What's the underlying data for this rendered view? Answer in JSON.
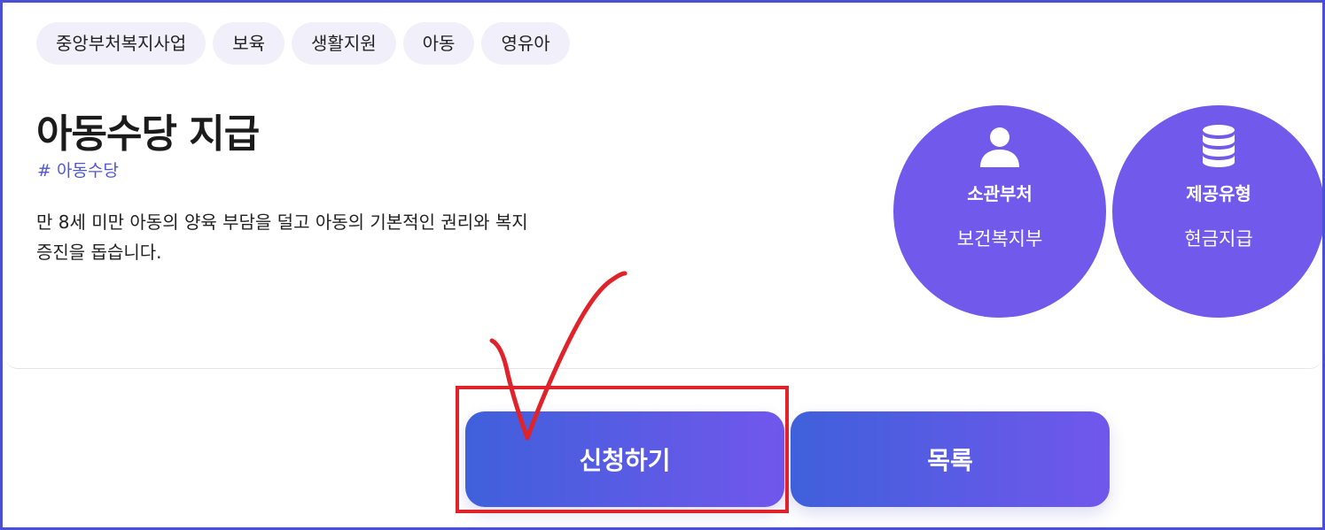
{
  "tags": [
    "중앙부처복지사업",
    "보육",
    "생활지원",
    "아동",
    "영유아"
  ],
  "service": {
    "title": "아동수당 지급",
    "hashtag": "# 아동수당",
    "description": "만 8세 미만 아동의 양육 부담을 덜고 아동의 기본적인 권리와 복지 증진을 돕습니다."
  },
  "info": {
    "ministry": {
      "label": "소관부처",
      "value": "보건복지부",
      "icon": "person-icon"
    },
    "provide_type": {
      "label": "제공유형",
      "value": "현금지급",
      "icon": "coin-stack-icon"
    }
  },
  "buttons": {
    "apply_label": "신청하기",
    "list_label": "목록"
  },
  "colors": {
    "accent": "#7159ec",
    "button_gradient_start": "#3f60db",
    "button_gradient_end": "#7157ec",
    "annotation_red": "#e0232b",
    "hashtag": "#4f56d6"
  }
}
